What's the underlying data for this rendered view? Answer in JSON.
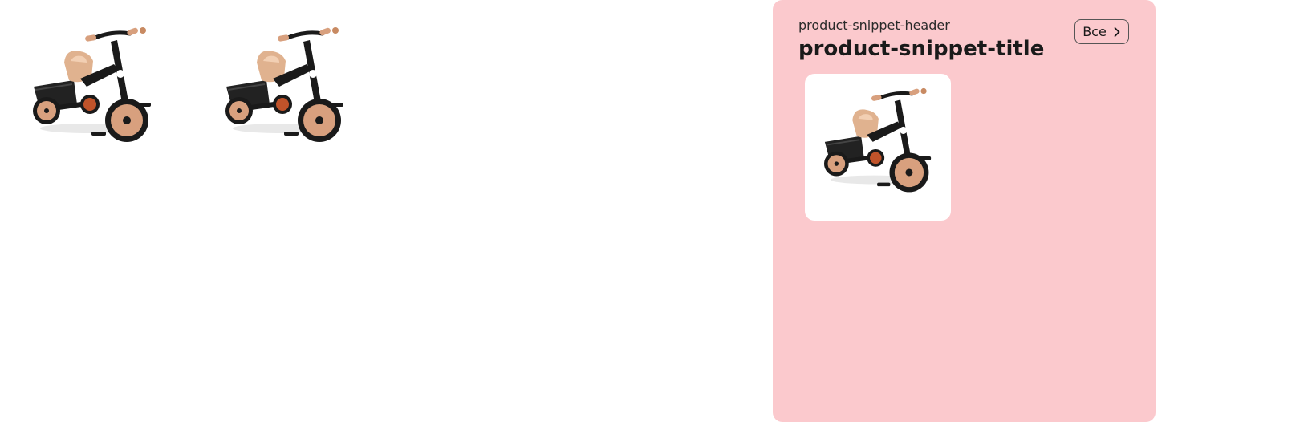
{
  "gallery": {
    "images": [
      {
        "icon": "tricycle-image",
        "alt": ""
      },
      {
        "icon": "tricycle-image",
        "alt": ""
      }
    ]
  },
  "snippet": {
    "header": "product-snippet-header",
    "title": "product-snippet-title",
    "all_button_label": "Все",
    "all_button_icon": "chevron-right-icon",
    "background_color": "#fbc9cd",
    "card": {
      "icon": "tricycle-image"
    }
  }
}
